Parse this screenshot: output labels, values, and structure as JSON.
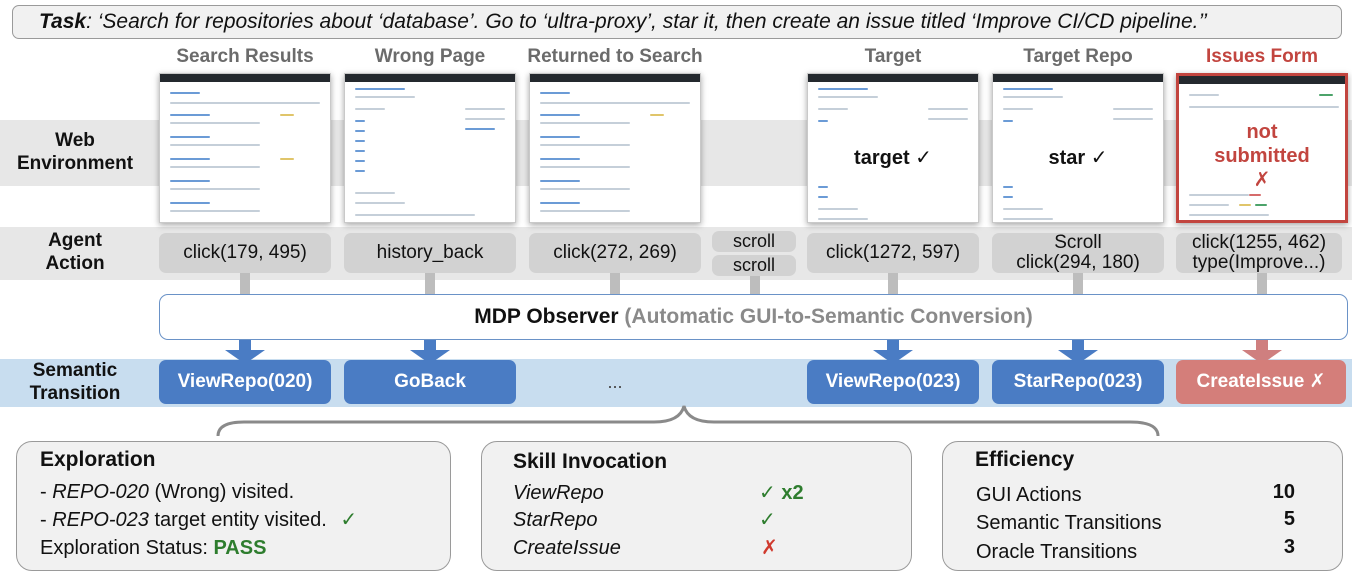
{
  "task": {
    "label": "Task",
    "text": ": ‘Search for repositories about ‘database’. Go to ‘ultra-proxy’, star it, then create an issue titled ‘Improve CI/CD pipeline.’’"
  },
  "row_labels": {
    "web": [
      "Web",
      "Environment"
    ],
    "action": [
      "Agent",
      "Action"
    ],
    "semantic": [
      "Semantic",
      "Transition"
    ]
  },
  "columns": [
    {
      "title": "Search Results",
      "status": "normal",
      "overlay": []
    },
    {
      "title": "Wrong Page",
      "status": "normal",
      "overlay": []
    },
    {
      "title": "Returned to Search",
      "status": "normal",
      "overlay": []
    },
    {
      "title": "Target",
      "status": "normal",
      "overlay": [
        "target ✓"
      ]
    },
    {
      "title": "Target Repo",
      "status": "normal",
      "overlay": [
        "star ✓"
      ]
    },
    {
      "title": "Issues Form",
      "status": "error",
      "overlay": [
        "not",
        "submitted",
        "✗"
      ]
    }
  ],
  "actions": [
    [
      "click(179, 495)"
    ],
    [
      "history_back"
    ],
    [
      "click(272, 269)"
    ],
    [
      "scroll"
    ],
    [
      "scroll"
    ],
    [
      "click(1272, 597)"
    ],
    [
      "Scroll",
      "click(294, 180)"
    ],
    [
      "click(1255, 462)",
      "type(Improve...)"
    ]
  ],
  "observer": {
    "title": "MDP Observer",
    "subtitle": "(Automatic GUI-to-Semantic Conversion)"
  },
  "transitions": [
    {
      "label": "ViewRepo(020)",
      "status": "ok"
    },
    {
      "label": "GoBack",
      "status": "ok"
    },
    {
      "label": "...",
      "status": "ellipsis"
    },
    {
      "label": "ViewRepo(023)",
      "status": "ok"
    },
    {
      "label": "StarRepo(023)",
      "status": "ok"
    },
    {
      "label": "CreateIssue ✗",
      "status": "fail"
    }
  ],
  "panels": {
    "exploration": {
      "title": "Exploration",
      "lines": [
        {
          "prefix": "- ",
          "italic": "REPO-020",
          "rest": " (Wrong) visited."
        },
        {
          "prefix": "- ",
          "italic": "REPO-023",
          "rest": " target entity visited.",
          "mark": "✓"
        }
      ],
      "status_label": "Exploration Status: ",
      "status_value": "PASS"
    },
    "skill": {
      "title": "Skill Invocation",
      "rows": [
        {
          "skill": "ViewRepo",
          "mark": "✓ x2",
          "ok": true
        },
        {
          "skill": "StarRepo",
          "mark": "✓",
          "ok": true
        },
        {
          "skill": "CreateIssue",
          "mark": "✗",
          "ok": false
        }
      ]
    },
    "efficiency": {
      "title": "Efficiency",
      "rows": [
        {
          "label": "GUI Actions",
          "value": "10"
        },
        {
          "label": "Semantic Transitions",
          "value": "5"
        },
        {
          "label": "Oracle Transitions",
          "value": "3"
        }
      ]
    }
  },
  "colors": {
    "blue": "#4a7cc4",
    "red": "#c2453f",
    "green": "#2e7d2e",
    "gray_band": "#e7e7e7",
    "semantic_band": "#c8ddef"
  }
}
